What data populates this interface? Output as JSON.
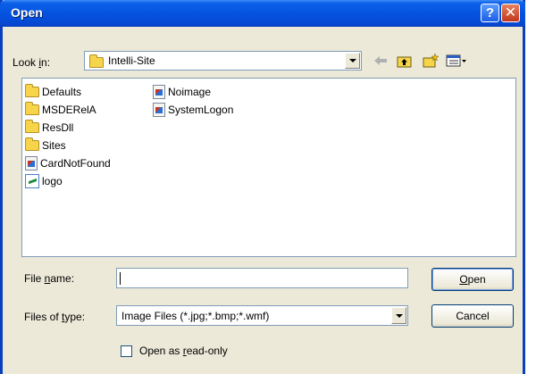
{
  "window": {
    "title": "Open",
    "help_glyph": "?",
    "close_glyph": "✕"
  },
  "look_in": {
    "label_pre": "Look ",
    "label_ul": "i",
    "label_post": "n:",
    "value": "Intelli-Site"
  },
  "toolbar": {
    "back_icon": "back-arrow-icon",
    "up_icon": "up-folder-icon",
    "new_folder_icon": "new-folder-icon",
    "views_icon": "views-menu-icon"
  },
  "files": {
    "column1": [
      {
        "name": "Defaults",
        "type": "folder"
      },
      {
        "name": "MSDERelA",
        "type": "folder"
      },
      {
        "name": "ResDll",
        "type": "folder"
      },
      {
        "name": "Sites",
        "type": "folder"
      },
      {
        "name": "CardNotFound",
        "type": "image"
      },
      {
        "name": "logo",
        "type": "logo"
      }
    ],
    "column2": [
      {
        "name": "Noimage",
        "type": "image"
      },
      {
        "name": "SystemLogon",
        "type": "image"
      }
    ]
  },
  "file_name": {
    "label_pre": "File ",
    "label_ul": "n",
    "label_post": "ame:",
    "value": ""
  },
  "file_type": {
    "label_pre": "Files of ",
    "label_ul": "t",
    "label_post": "ype:",
    "value": "Image Files (*.jpg;*.bmp;*.wmf)"
  },
  "buttons": {
    "open_ul": "O",
    "open_rest": "pen",
    "cancel": "Cancel"
  },
  "read_only": {
    "label_pre": "Open as ",
    "label_ul": "r",
    "label_post": "ead-only",
    "checked": false
  }
}
